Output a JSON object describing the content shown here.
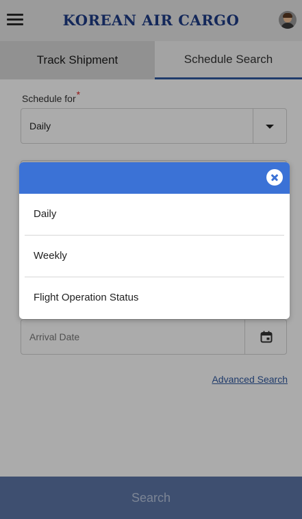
{
  "header": {
    "logo_text": "KOREAN AIR CARGO"
  },
  "tabs": [
    {
      "label": "Track Shipment"
    },
    {
      "label": "Schedule Search"
    }
  ],
  "form": {
    "schedule_label": "Schedule for",
    "required_mark": "*",
    "schedule_value": "Daily",
    "arrival_placeholder": "Arrival Date",
    "advanced_search": "Advanced Search"
  },
  "search_button": "Search",
  "modal": {
    "options": [
      {
        "label": "Daily"
      },
      {
        "label": "Weekly"
      },
      {
        "label": "Flight Operation Status"
      }
    ]
  },
  "colors": {
    "brand": "#1f3c86",
    "modal_header": "#3b72d6",
    "search_bar": "#5d77a8",
    "tab_underline": "#2f58a0"
  }
}
